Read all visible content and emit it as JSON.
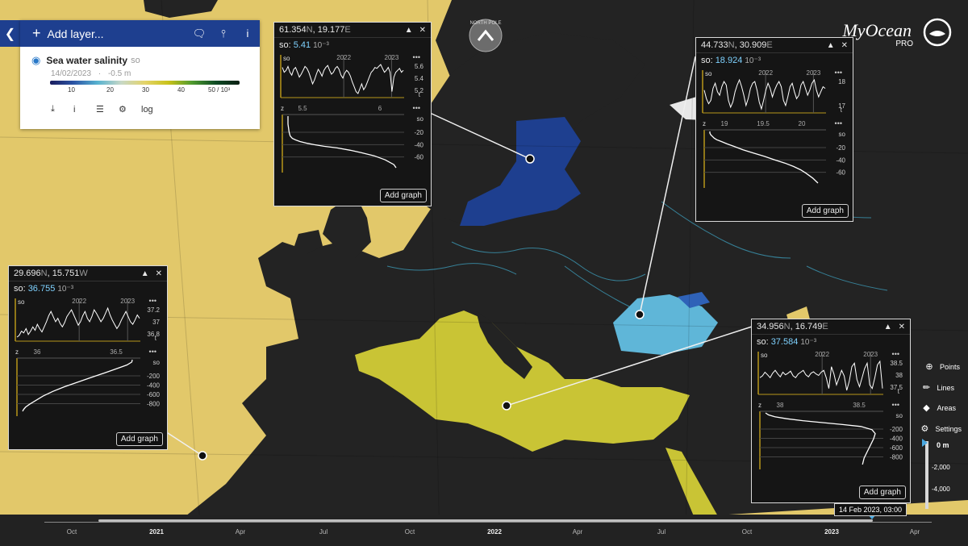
{
  "layer_panel": {
    "add_layer_label": "Add layer...",
    "layer_name": "Sea water salinity",
    "layer_code": "so",
    "date": "14/02/2023",
    "sep": "·",
    "depth": "-0.5 m",
    "colorbar_ticks": [
      "10",
      "20",
      "30",
      "40",
      "50 / 10³"
    ],
    "colorbar_colors": [
      "#1b1d5e",
      "#2b54a5",
      "#57b2d0",
      "#c7d8c7",
      "#e4d46a",
      "#c9c21a",
      "#4e9a2f",
      "#0d4a24",
      "#0b1f13"
    ],
    "log_label": "log"
  },
  "popups": [
    {
      "id": "baltic",
      "coords_lat": "61.354",
      "coords_lat_hemi": "N",
      "coords_lon": "19.177",
      "coords_lon_hemi": "E",
      "var_label": "so:",
      "value": "5.41",
      "unit": "10⁻³",
      "ts_label": "so",
      "ts_years": [
        "2022",
        "2023"
      ],
      "ts_y_ticks": [
        "5.6",
        "5.4",
        "5.2"
      ],
      "ts_t_label": "t",
      "ts_series": [
        5.55,
        5.5,
        5.52,
        5.56,
        5.5,
        5.47,
        5.53,
        5.55,
        5.5,
        5.45,
        5.48,
        5.52,
        5.56,
        5.54,
        5.5,
        5.44,
        5.38,
        5.42,
        5.48,
        5.53,
        5.5,
        5.46,
        5.52,
        5.55,
        5.57,
        5.52,
        5.48,
        5.5,
        5.54,
        5.56,
        5.53,
        5.47,
        5.44,
        5.49,
        5.52,
        5.5,
        5.46,
        5.4,
        5.35,
        5.3,
        5.28,
        5.33,
        5.38,
        5.32,
        5.35,
        5.4,
        5.45,
        5.5,
        5.52,
        5.55,
        5.54,
        5.56,
        5.58,
        5.54,
        5.5,
        5.52,
        5.55,
        5.5,
        5.3,
        5.45,
        5.5,
        5.52,
        5.54,
        5.5,
        5.52
      ],
      "pf_label": "z",
      "pf_x_ticks": [
        "5.5",
        "6"
      ],
      "pf_var": "so",
      "pf_y_ticks": [
        "-20",
        "-40",
        "-60"
      ],
      "pf_x": [
        5.41,
        5.41,
        5.42,
        5.43,
        5.45,
        5.48,
        5.52,
        5.58,
        5.65,
        5.74,
        5.86,
        5.98,
        6.08,
        6.2,
        6.3,
        6.38,
        6.4
      ],
      "pf_z": [
        0,
        -10,
        -20,
        -25,
        -28,
        -30,
        -32,
        -34,
        -36,
        -38,
        -40,
        -43,
        -46,
        -50,
        -55,
        -61,
        -65
      ],
      "add_graph": "Add graph"
    },
    {
      "id": "black-sea",
      "coords_lat": "44.733",
      "coords_lat_hemi": "N",
      "coords_lon": "30.909",
      "coords_lon_hemi": "E",
      "var_label": "so:",
      "value": "18.924",
      "unit": "10⁻³",
      "ts_label": "so",
      "ts_years": [
        "2022",
        "2023"
      ],
      "ts_y_ticks": [
        "18",
        "17"
      ],
      "ts_t_label": "t",
      "ts_series": [
        17.9,
        17.4,
        17.1,
        17.3,
        18.0,
        18.3,
        17.8,
        17.6,
        18.1,
        18.4,
        18.2,
        17.3,
        16.9,
        17.2,
        17.8,
        18.2,
        18.5,
        18.1,
        17.6,
        17.0,
        17.4,
        18.0,
        18.3,
        18.4,
        17.9,
        17.2,
        16.8,
        17.3,
        17.9,
        18.3,
        18.0,
        17.5,
        17.9,
        18.2,
        18.4,
        18.1,
        17.3,
        17.0,
        17.5,
        18.1,
        18.3,
        17.8,
        17.4,
        17.6,
        18.2,
        18.4,
        18.0,
        17.6,
        17.9,
        18.3,
        18.5,
        17.9,
        17.5,
        17.8,
        18.1,
        18.0
      ],
      "pf_label": "z",
      "pf_x_ticks": [
        "19",
        "19.5",
        "20"
      ],
      "pf_var": "so",
      "pf_y_ticks": [
        "-20",
        "-40",
        "-60"
      ],
      "pf_x": [
        18.92,
        18.92,
        18.93,
        18.95,
        18.97,
        19.0,
        19.05,
        19.12,
        19.2,
        19.3,
        19.42,
        19.55,
        19.66,
        19.78,
        19.88,
        19.96,
        20.02,
        20.1,
        20.16
      ],
      "pf_z": [
        0,
        -2,
        -4,
        -6,
        -8,
        -10,
        -12,
        -15,
        -18,
        -22,
        -26,
        -30,
        -34,
        -38,
        -42,
        -46,
        -50,
        -56,
        -62
      ],
      "add_graph": "Add graph"
    },
    {
      "id": "atlantic",
      "coords_lat": "29.696",
      "coords_lat_hemi": "N",
      "coords_lon": "15.751",
      "coords_lon_hemi": "W",
      "var_label": "so:",
      "value": "36.755",
      "unit": "10⁻³",
      "ts_label": "so",
      "ts_years": [
        "2022",
        "2023"
      ],
      "ts_y_ticks": [
        "37.2",
        "37",
        "36.8"
      ],
      "ts_t_label": "t",
      "ts_series": [
        36.8,
        36.82,
        36.87,
        36.85,
        36.9,
        36.83,
        36.87,
        36.92,
        36.88,
        36.95,
        36.9,
        36.86,
        36.92,
        36.98,
        37.05,
        37.1,
        37.04,
        36.98,
        37.02,
        36.96,
        36.92,
        36.97,
        37.04,
        37.08,
        37.12,
        37.06,
        37.0,
        36.94,
        36.98,
        37.05,
        37.1,
        37.02,
        36.98,
        37.04,
        37.12,
        37.08,
        37.03,
        36.98,
        37.02,
        37.08,
        37.14,
        37.06,
        37.0,
        36.95,
        36.9,
        36.94,
        37.0,
        37.05,
        37.1,
        37.04,
        36.98,
        36.95,
        37.0,
        37.06,
        37.02
      ],
      "pf_label": "z",
      "pf_x_ticks": [
        "36",
        "36.5"
      ],
      "pf_var": "so",
      "pf_y_ticks": [
        "-200",
        "-400",
        "-600",
        "-800"
      ],
      "pf_x": [
        36.755,
        36.75,
        36.7,
        36.6,
        36.48,
        36.34,
        36.2,
        36.06,
        35.94,
        35.84,
        35.76,
        35.7,
        35.66,
        35.64,
        35.63
      ],
      "pf_z": [
        0,
        -40,
        -90,
        -150,
        -220,
        -300,
        -380,
        -460,
        -540,
        -620,
        -700,
        -760,
        -810,
        -850,
        -880
      ],
      "add_graph": "Add graph"
    },
    {
      "id": "mediterranean",
      "coords_lat": "34.956",
      "coords_lat_hemi": "N",
      "coords_lon": "16.749",
      "coords_lon_hemi": "E",
      "var_label": "so:",
      "value": "37.584",
      "unit": "10⁻³",
      "ts_label": "so",
      "ts_years": [
        "2022",
        "2023"
      ],
      "ts_y_ticks": [
        "38.5",
        "38",
        "37.5"
      ],
      "ts_t_label": "t",
      "ts_series": [
        37.9,
        37.95,
        38.05,
        37.98,
        37.9,
        38.02,
        38.1,
        38.0,
        37.92,
        38.05,
        37.98,
        38.02,
        38.08,
        37.95,
        37.9,
        38.0,
        38.05,
        38.1,
        37.98,
        37.92,
        38.02,
        38.06,
        38.0,
        37.96,
        38.05,
        38.1,
        37.9,
        37.6,
        38.2,
        38.0,
        37.7,
        37.9,
        38.1,
        37.95,
        37.55,
        37.8,
        38.2,
        38.3,
        37.85,
        37.65,
        37.9,
        38.15,
        38.3,
        37.7,
        37.6,
        37.9,
        38.25,
        38.35,
        37.6
      ],
      "pf_label": "z",
      "pf_x_ticks": [
        "38",
        "38.5"
      ],
      "pf_var": "so",
      "pf_y_ticks": [
        "-200",
        "-400",
        "-600",
        "-800"
      ],
      "pf_x": [
        37.584,
        37.62,
        37.7,
        37.85,
        38.05,
        38.3,
        38.55,
        38.78,
        38.92,
        38.96,
        38.94,
        38.9,
        38.86,
        38.82,
        38.8
      ],
      "pf_z": [
        0,
        -30,
        -60,
        -90,
        -120,
        -150,
        -180,
        -210,
        -260,
        -320,
        -400,
        -500,
        -600,
        -700,
        -800
      ],
      "add_graph": "Add graph"
    }
  ],
  "toolbox": [
    {
      "label": "Points",
      "icon": "crosshair-icon"
    },
    {
      "label": "Lines",
      "icon": "ruler-icon"
    },
    {
      "label": "Areas",
      "icon": "area-icon"
    },
    {
      "label": "Settings",
      "icon": "gear-icon"
    }
  ],
  "depth_scale": {
    "current": "0 m",
    "ticks": [
      "-2,000",
      "-4,000"
    ]
  },
  "north_pole": "NORTH POLE",
  "logo": {
    "main": "MyOcean",
    "sub": "PRO"
  },
  "timeline": {
    "labels": [
      {
        "text": "Oct",
        "year": false
      },
      {
        "text": "2021",
        "year": true
      },
      {
        "text": "Apr",
        "year": false
      },
      {
        "text": "Jul",
        "year": false
      },
      {
        "text": "Oct",
        "year": false
      },
      {
        "text": "2022",
        "year": true
      },
      {
        "text": "Apr",
        "year": false
      },
      {
        "text": "Jul",
        "year": false
      },
      {
        "text": "Oct",
        "year": false
      },
      {
        "text": "2023",
        "year": true
      },
      {
        "text": "Apr",
        "year": false
      }
    ],
    "current": "14 Feb 2023, 03:00"
  },
  "colors": {
    "ocean_atlantic": "#e2c86a",
    "land": "#232323",
    "mediterranean": "#c9c435",
    "black_sea": "#5fb6d8",
    "baltic": "#1e3f8f",
    "header": "#1e3f8f",
    "accent": "#7fd2ff"
  }
}
